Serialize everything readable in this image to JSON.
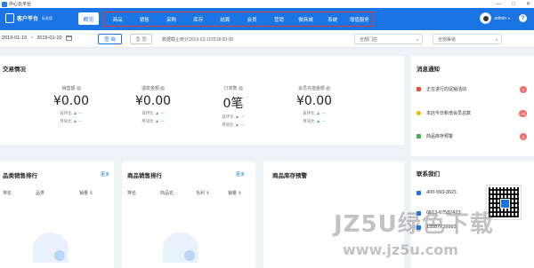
{
  "window": {
    "title": "中心云平台",
    "controls": [
      "—",
      "□",
      "✕"
    ]
  },
  "nav": {
    "brand": "客户平台",
    "brand_tag": "标准版",
    "overview": "概览",
    "items": [
      "商品",
      "销售",
      "采购",
      "库存",
      "结算",
      "会员",
      "营销",
      "微商城",
      "系统",
      "增值服务"
    ],
    "user_name": "admin",
    "user_caret": "▾",
    "help": "?"
  },
  "filter": {
    "date_start": "2019-01-10",
    "date_sep": "~",
    "date_end": "2019-01-10",
    "query_label": "查 询",
    "reset_label": "重 置",
    "note": "数据截止统计2019-01-10日18:00:00",
    "store_select": "全部门店",
    "channel_select": "全部渠道"
  },
  "trade": {
    "title": "交易情况",
    "metrics": [
      {
        "label": "销售额",
        "value": "¥0.00",
        "day": "日环比",
        "month": "月同比",
        "delta": "---"
      },
      {
        "label": "退款金额",
        "value": "¥0.00",
        "day": "日环比",
        "month": "月同比",
        "delta": "---"
      },
      {
        "label": "订单数",
        "value": "0笔",
        "day": "日环比",
        "month": "月同比",
        "delta": "---"
      },
      {
        "label": "会员充值金额",
        "value": "¥0.00",
        "day": "日环比",
        "month": "月同比",
        "delta": "---"
      }
    ]
  },
  "notice": {
    "title": "消息通知",
    "items": [
      {
        "label": "正在进行的促销活动",
        "badge": "0",
        "color": "#e74c3c"
      },
      {
        "label": "本店今日新增会员总数",
        "badge": "+0",
        "color": "#f5b400"
      },
      {
        "label": "商品库存预警",
        "badge": "0",
        "color": "#3ab54a"
      }
    ]
  },
  "category_rank": {
    "title": "品类销售排行",
    "more": "更多",
    "columns": [
      "排名",
      "品类",
      "销量"
    ]
  },
  "goods_rank": {
    "title": "商品销售排行",
    "more": "更多",
    "columns": [
      "排名",
      "商品名",
      "毛利",
      "销量"
    ]
  },
  "stock_warning": {
    "title": "商品库存预警"
  },
  "contact": {
    "title": "联系我们",
    "phone": "400-993-3621",
    "tel": "0513-67582423",
    "mobile": "13587739993"
  },
  "watermark": {
    "line1": "JZ5U绿色下载",
    "line2": "www.jz5u.com"
  },
  "colors": {
    "brand_blue": "#1a74e4",
    "badge_red": "#f56c6c",
    "up_green": "#3ab54a"
  }
}
